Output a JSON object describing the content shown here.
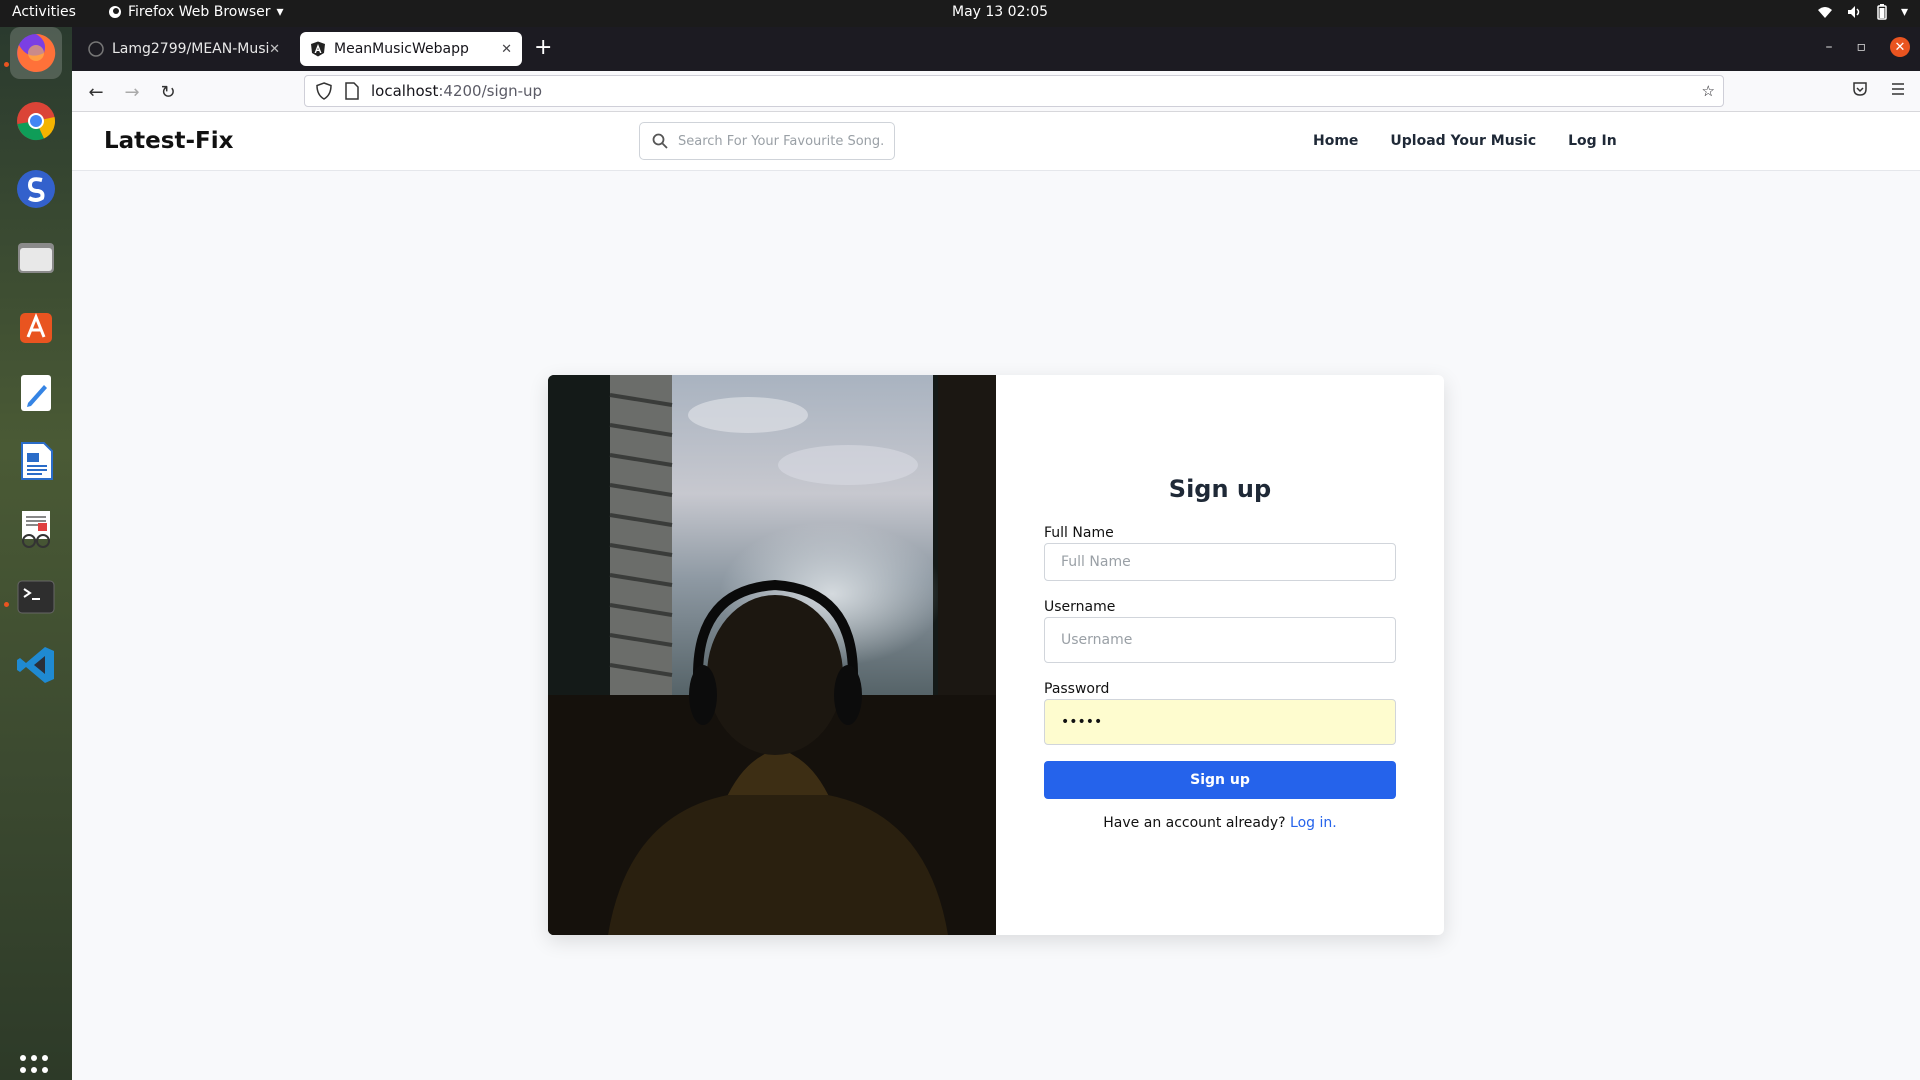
{
  "topbar": {
    "activities": "Activities",
    "app_menu": "Firefox Web Browser",
    "clock": "May 13  02:05"
  },
  "dock": {
    "icons": [
      "firefox-icon",
      "chrome-icon",
      "simplenote-icon",
      "files-icon",
      "app-store-icon",
      "text-editor-icon",
      "writer-icon",
      "document-viewer-icon",
      "terminal-icon",
      "vscode-icon",
      "app-grid-icon"
    ]
  },
  "browser": {
    "tabs": [
      {
        "title": "Lamg2799/MEAN-Music-",
        "active": false
      },
      {
        "title": "MeanMusicWebapp",
        "active": true
      }
    ],
    "url_host": "localhost",
    "url_path": ":4200/sign-up"
  },
  "site": {
    "brand": "Latest-Fix",
    "search_placeholder": "Search For Your Favourite Song..",
    "nav": [
      "Home",
      "Upload Your Music",
      "Log In"
    ]
  },
  "signup": {
    "title": "Sign up",
    "full_name_label": "Full Name",
    "full_name_placeholder": "Full Name",
    "username_label": "Username",
    "username_placeholder": "Username",
    "password_label": "Password",
    "password_value": "•••••",
    "submit_label": "Sign up",
    "have_account_text": "Have an account already?",
    "login_link": "Log in."
  },
  "colors": {
    "primary": "#2563eb",
    "autofill": "#fefccf",
    "ubuntu_orange": "#e95420"
  }
}
